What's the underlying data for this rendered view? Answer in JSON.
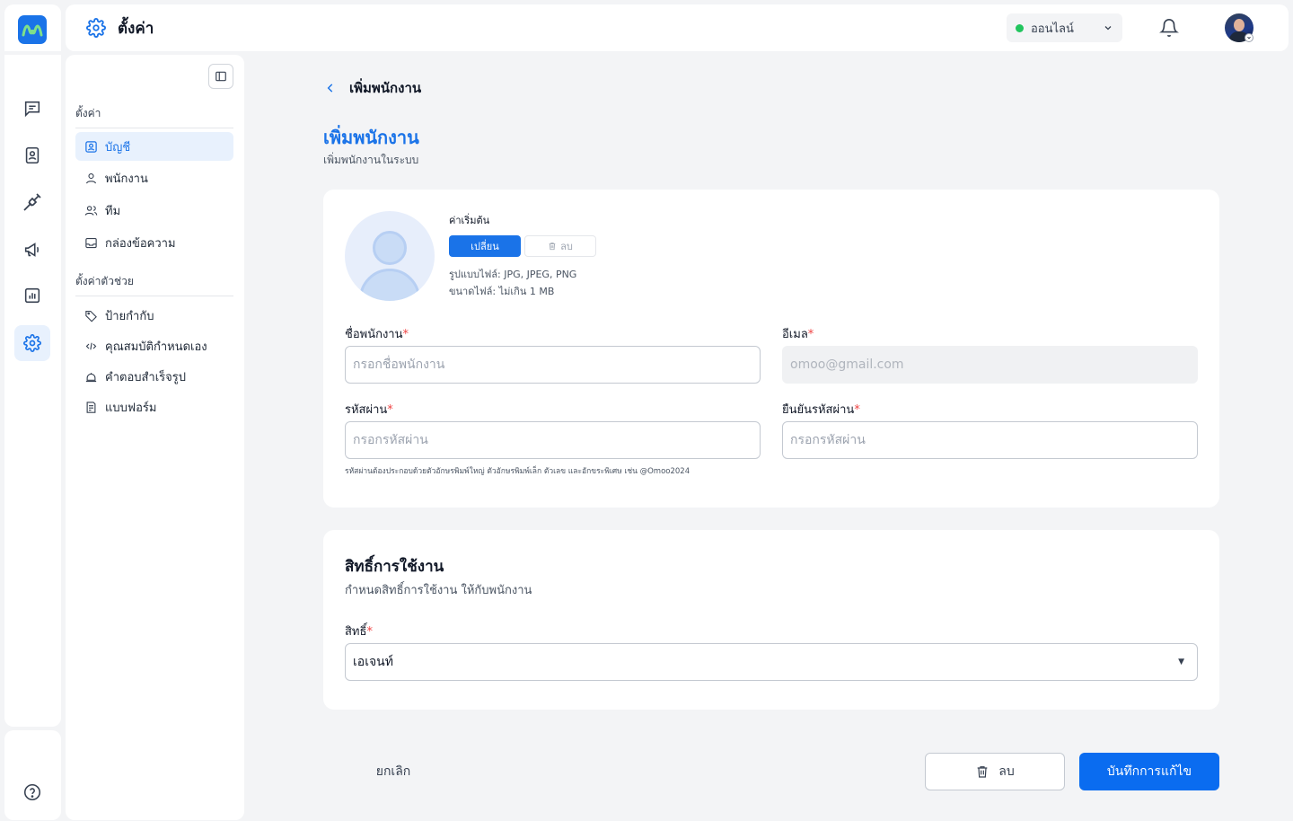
{
  "header": {
    "title": "ตั้งค่า",
    "status": {
      "label": "ออนไลน์",
      "color": "#22c55e"
    }
  },
  "rail": {
    "items": [
      "chat-icon",
      "contacts-icon",
      "integration-icon",
      "broadcast-icon",
      "reports-icon",
      "settings-icon"
    ],
    "active": "settings-icon",
    "bottom": "help-icon"
  },
  "sidebar": {
    "section1": "ตั้งค่า",
    "items1": [
      {
        "label": "บัญชี",
        "icon": "user-square-icon",
        "active": true
      },
      {
        "label": "พนักงาน",
        "icon": "user-icon"
      },
      {
        "label": "ทีม",
        "icon": "users-icon"
      },
      {
        "label": "กล่องข้อความ",
        "icon": "inbox-icon"
      }
    ],
    "section2": "ตั้งค่าตัวช่วย",
    "items2": [
      {
        "label": "ป้ายกำกับ",
        "icon": "tag-icon"
      },
      {
        "label": "คุณสมบัติกำหนดเอง",
        "icon": "code-icon"
      },
      {
        "label": "คำตอบสำเร็จรูป",
        "icon": "canned-response-icon"
      },
      {
        "label": "แบบฟอร์ม",
        "icon": "form-icon"
      }
    ]
  },
  "main": {
    "breadcrumb": "เพิ่มพนักงาน",
    "title": "เพิ่มพนักงาน",
    "subtitle": "เพิ่มพนักงานในระบบ"
  },
  "profile": {
    "default_label": "ค่าเริ่มต้น",
    "change_label": "เปลี่ยน",
    "delete_label": "ลบ",
    "format_note": "รูปแบบไฟล์: JPG, JPEG, PNG",
    "size_note": "ขนาดไฟล์: ไม่เกิน 1 MB"
  },
  "form": {
    "name_label": "ชื่อพนักงาน",
    "name_placeholder": "กรอกชื่อพนักงาน",
    "email_label": "อีเมล",
    "email_value": "omoo@gmail.com",
    "password_label": "รหัสผ่าน",
    "password_placeholder": "กรอกรหัสผ่าน",
    "confirm_label": "ยืนยันรหัสผ่าน",
    "confirm_placeholder": "กรอกรหัสผ่าน",
    "password_hint": "รหัสผ่านต้องประกอบด้วยตัวอักษรพิมพ์ใหญ่ ตัวอักษรพิมพ์เล็ก ตัวเลข และอักขระพิเศษ เช่น @Omoo2024",
    "required_mark": "*"
  },
  "permissions": {
    "title": "สิทธิ์การใช้งาน",
    "subtitle": "กำหนดสิทธิ์การใช้งาน ให้กับพนักงาน",
    "role_label": "สิทธิ์",
    "role_value": "เอเจนท์"
  },
  "actions": {
    "cancel": "ยกเลิก",
    "delete": "ลบ",
    "save": "บันทึกการแก้ไข"
  },
  "colors": {
    "accent": "#1a73e8",
    "required": "#ef4444"
  }
}
